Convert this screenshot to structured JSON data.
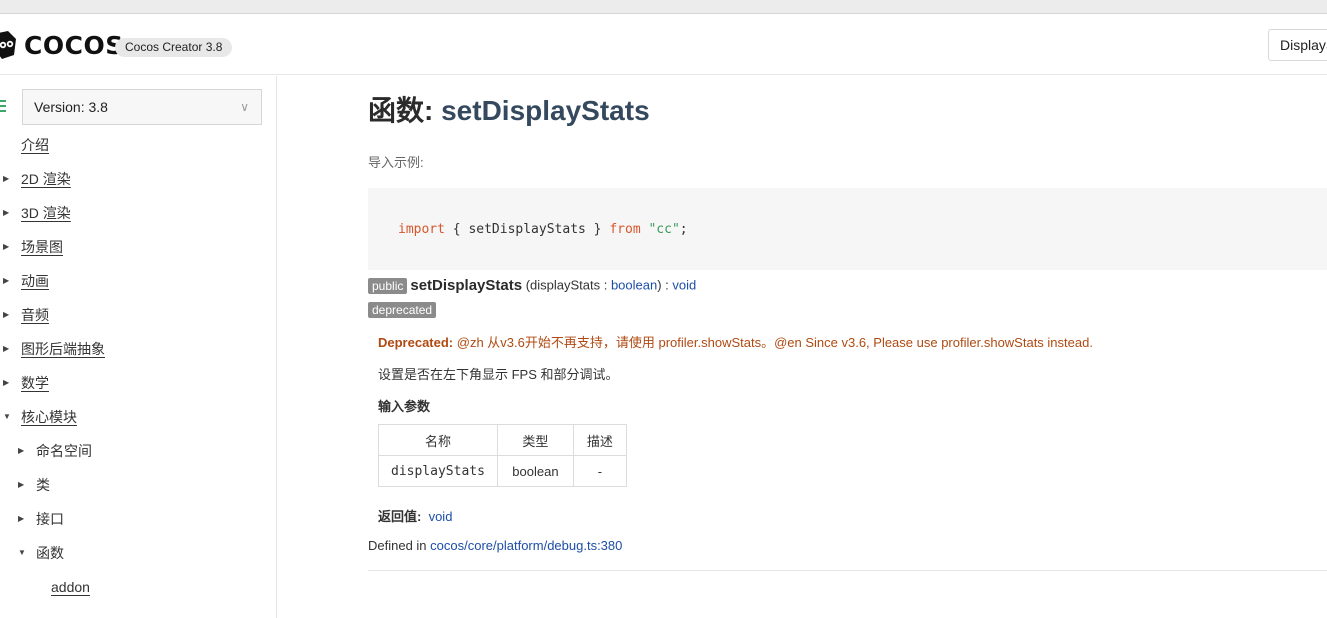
{
  "header": {
    "logo_text": "COCOS",
    "version_badge": "Cocos Creator 3.8",
    "search_value": "DisplayS"
  },
  "sidebar": {
    "version_select": "Version: 3.8",
    "items": [
      {
        "label": "介绍",
        "arrow": "",
        "expanded": false
      },
      {
        "label": "2D 渲染",
        "arrow": "▶"
      },
      {
        "label": "3D 渲染",
        "arrow": "▶"
      },
      {
        "label": "场景图",
        "arrow": "▶"
      },
      {
        "label": "动画",
        "arrow": "▶"
      },
      {
        "label": "音频",
        "arrow": "▶"
      },
      {
        "label": "图形后端抽象",
        "arrow": "▶"
      },
      {
        "label": "数学",
        "arrow": "▶"
      },
      {
        "label": "核心模块",
        "arrow": "▼"
      },
      {
        "label": "命名空间",
        "arrow": "▶"
      },
      {
        "label": "类",
        "arrow": "▶"
      },
      {
        "label": "接口",
        "arrow": "▶"
      },
      {
        "label": "函数",
        "arrow": "▼"
      },
      {
        "label": "addon",
        "arrow": ""
      }
    ]
  },
  "content": {
    "title_prefix": "函数: ",
    "title_name": "setDisplayStats",
    "import_hint": "导入示例:",
    "code": {
      "import_kw": "import",
      "body": " { setDisplayStats } ",
      "from_kw": "from",
      "module": "\"cc\"",
      "end": ";"
    },
    "signature": {
      "visibility": "public",
      "name": "setDisplayStats",
      "params_open": " (displayStats : ",
      "param_type": "boolean",
      "params_close": ") : ",
      "return_type": "void"
    },
    "deprecated_badge": "deprecated",
    "deprecated_label": "Deprecated:",
    "deprecated_text": " @zh 从v3.6开始不再支持，请使用 profiler.showStats。@en Since v3.6, Please use profiler.showStats instead.",
    "description": "设置是否在左下角显示 FPS 和部分调试。",
    "params_heading": "输入参数",
    "params_table": {
      "headers": [
        "名称",
        "类型",
        "描述"
      ],
      "rows": [
        {
          "name": "displayStats",
          "type": "boolean",
          "desc": "-"
        }
      ]
    },
    "return_label": "返回值:",
    "return_value": "void",
    "defined_in_label": "Defined in ",
    "defined_in_link": "cocos/core/platform/debug.ts:380"
  }
}
